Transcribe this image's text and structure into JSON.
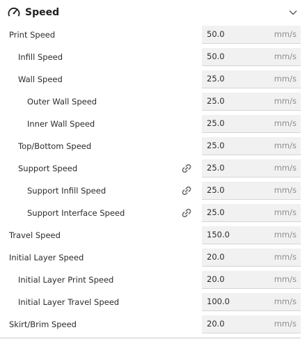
{
  "section": {
    "title": "Speed",
    "icon": "gauge-icon",
    "collapse_icon": "chevron-down-icon"
  },
  "unit": "mm/s",
  "rows": [
    {
      "label": "Print Speed",
      "value": "50.0",
      "level": 0,
      "linked": false
    },
    {
      "label": "Infill Speed",
      "value": "50.0",
      "level": 1,
      "linked": false
    },
    {
      "label": "Wall Speed",
      "value": "25.0",
      "level": 1,
      "linked": false
    },
    {
      "label": "Outer Wall Speed",
      "value": "25.0",
      "level": 2,
      "linked": false
    },
    {
      "label": "Inner Wall Speed",
      "value": "25.0",
      "level": 2,
      "linked": false
    },
    {
      "label": "Top/Bottom Speed",
      "value": "25.0",
      "level": 1,
      "linked": false
    },
    {
      "label": "Support Speed",
      "value": "25.0",
      "level": 1,
      "linked": true
    },
    {
      "label": "Support Infill Speed",
      "value": "25.0",
      "level": 2,
      "linked": true
    },
    {
      "label": "Support Interface Speed",
      "value": "25.0",
      "level": 2,
      "linked": true
    },
    {
      "label": "Travel Speed",
      "value": "150.0",
      "level": 0,
      "linked": false
    },
    {
      "label": "Initial Layer Speed",
      "value": "20.0",
      "level": 0,
      "linked": false
    },
    {
      "label": "Initial Layer Print Speed",
      "value": "20.0",
      "level": 1,
      "linked": false
    },
    {
      "label": "Initial Layer Travel Speed",
      "value": "100.0",
      "level": 1,
      "linked": false
    },
    {
      "label": "Skirt/Brim Speed",
      "value": "20.0",
      "level": 0,
      "linked": false
    }
  ],
  "colors": {
    "field_background": "#f1f1f1",
    "unit_text": "#8e8e8e",
    "label_text": "#2b2b2b"
  }
}
